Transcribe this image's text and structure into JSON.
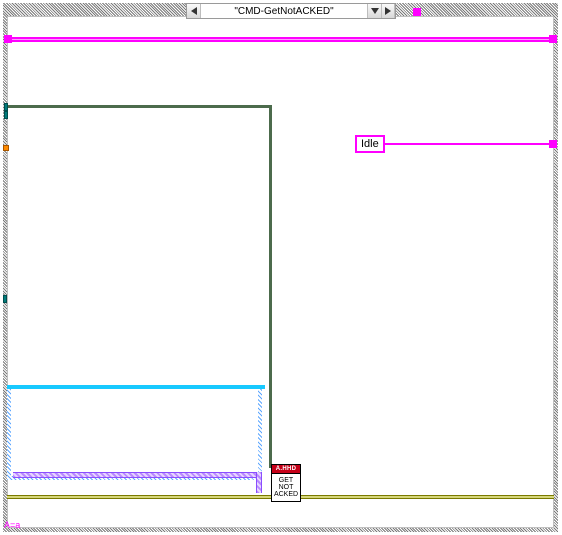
{
  "case_selector": {
    "value": "\"CMD-GetNotACKED\""
  },
  "constants": {
    "idle_label": "Idle"
  },
  "vi_node": {
    "header": "A.HHD",
    "body": "GET\nNOT\nACKED"
  },
  "footer": {
    "aa_text": "A=a"
  },
  "wires": {
    "top_bus_color": "#ff00ff",
    "bottom_bus_color": "#7a7a00",
    "green_wire_color": "#4c6b4c",
    "purple_wire_color": "#8a4dff",
    "idle_wire_color": "#ff00ff"
  }
}
